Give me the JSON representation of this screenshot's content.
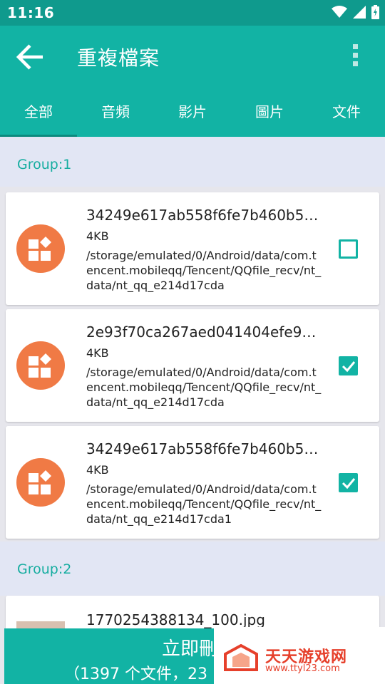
{
  "status_bar": {
    "time": "11:16"
  },
  "app_bar": {
    "title": "重複檔案"
  },
  "tabs": [
    {
      "label": "全部",
      "active": true
    },
    {
      "label": "音頻",
      "active": false
    },
    {
      "label": "影片",
      "active": false
    },
    {
      "label": "圖片",
      "active": false
    },
    {
      "label": "文件",
      "active": false
    }
  ],
  "groups": [
    {
      "label": "Group:1",
      "files": [
        {
          "name": "34249e617ab558f6fe7b460b5…",
          "size": "4KB",
          "path": "/storage/emulated/0/Android/data/com.tencent.mobileqq/Tencent/QQfile_recv/nt_data/nt_qq_e214d17cda",
          "checked": false
        },
        {
          "name": "2e93f70ca267aed041404efe9…",
          "size": "4KB",
          "path": "/storage/emulated/0/Android/data/com.tencent.mobileqq/Tencent/QQfile_recv/nt_data/nt_qq_e214d17cda",
          "checked": true
        },
        {
          "name": "34249e617ab558f6fe7b460b5…",
          "size": "4KB",
          "path": "/storage/emulated/0/Android/data/com.tencent.mobileqq/Tencent/QQfile_recv/nt_data/nt_qq_e214d17cda1",
          "checked": true
        }
      ]
    },
    {
      "label": "Group:2",
      "files": [
        {
          "name": "1770254388134_100.jpg"
        }
      ]
    }
  ],
  "delete_button": {
    "label": "立即刪",
    "summary": "（1397 个文件，23"
  },
  "watermark": {
    "name": "天天游戏网",
    "url": "www.ttyl23.com"
  },
  "colors": {
    "primary": "#12b3a4",
    "status_bar": "#0f9a8d",
    "file_icon": "#f07a45",
    "group_bg": "#e2e6f4"
  }
}
